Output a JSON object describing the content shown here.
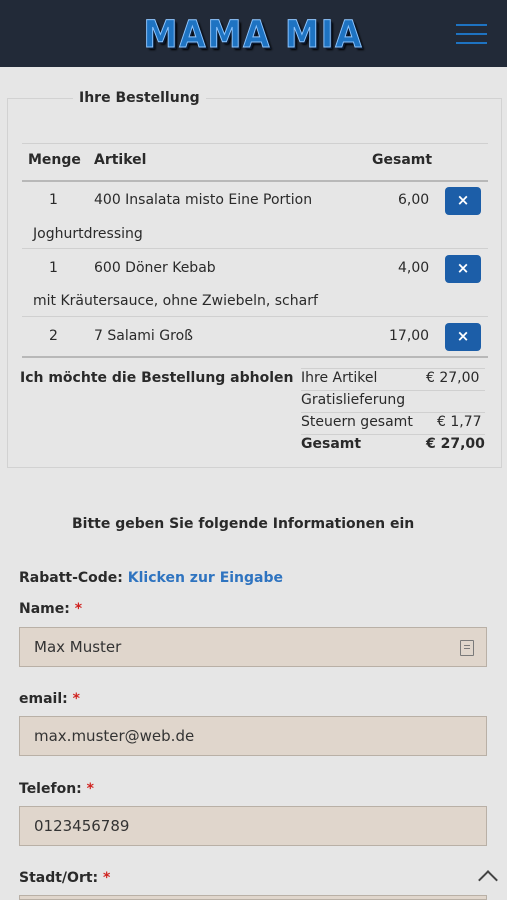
{
  "header": {
    "logo_text": "MAMA MIA",
    "menu_icon": "hamburger-menu-icon"
  },
  "order": {
    "title": "Ihre Bestellung",
    "columns": {
      "qty": "Menge",
      "item": "Artikel",
      "total": "Gesamt"
    },
    "remove_label": "×",
    "items": [
      {
        "qty": "1",
        "name": "400 Insalata misto Eine Portion",
        "price": "6,00",
        "note": "Joghurtdressing"
      },
      {
        "qty": "1",
        "name": "600 Döner Kebab",
        "price": "4,00",
        "note": "mit Kräutersauce, ohne Zwiebeln, scharf"
      },
      {
        "qty": "2",
        "name": "7 Salami Groß",
        "price": "17,00",
        "note": ""
      }
    ],
    "pickup_label": "Ich möchte die Bestellung abholen",
    "summary": {
      "items_label": "Ihre Artikel",
      "items_value": "€ 27,00",
      "delivery_label": "Gratislieferung",
      "tax_label": "Steuern gesamt",
      "tax_value": "€ 1,77",
      "total_label": "Gesamt",
      "total_value": "€ 27,00"
    }
  },
  "form": {
    "title": "Bitte geben Sie folgende Informationen ein",
    "discount_label": "Rabatt-Code:",
    "discount_link": "Klicken zur Eingabe",
    "required_mark": "*",
    "name_label": "Name:",
    "name_value": "Max Muster",
    "email_label": "email:",
    "email_value": "max.muster@web.de",
    "phone_label": "Telefon:",
    "phone_value": "0123456789",
    "city_label": "Stadt/Ort:"
  }
}
